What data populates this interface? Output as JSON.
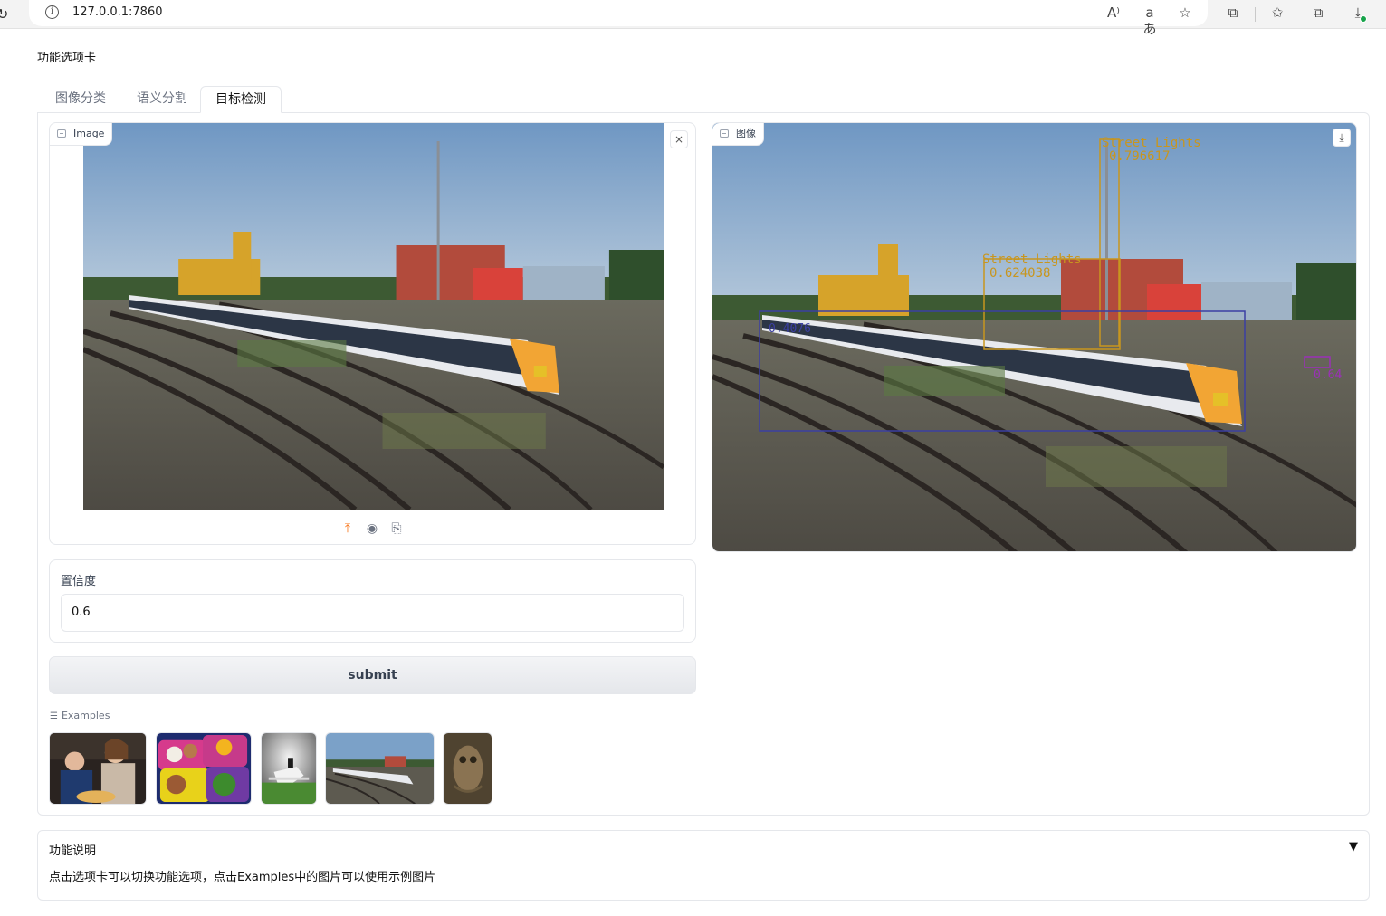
{
  "browser": {
    "url": "127.0.0.1:7860",
    "info_glyph": "i",
    "icons": [
      "read-aloud-icon",
      "translate-icon",
      "favorite-star-icon",
      "extensions-icon",
      "favorites-icon",
      "collections-icon",
      "downloads-icon"
    ],
    "read_aloud": "A⁾",
    "translate": "aあ",
    "favorite": "☆",
    "extensions": "⧉",
    "favorites": "✩",
    "collections": "⧉",
    "downloads": "⤓"
  },
  "page": {
    "heading": "功能选项卡",
    "tabs": [
      {
        "label": "图像分类",
        "active": false
      },
      {
        "label": "语义分割",
        "active": false
      },
      {
        "label": "目标检测",
        "active": true
      }
    ]
  },
  "input_image": {
    "label": "Image",
    "clear_glyph": "×",
    "source_icons": [
      "upload-icon",
      "webcam-icon",
      "clipboard-icon"
    ],
    "upload_glyph": "⤒",
    "webcam_glyph": "◉",
    "clipboard_glyph": "⎘"
  },
  "output_image": {
    "label": "图像",
    "download_glyph": "⤓",
    "detections": [
      {
        "label": "Street Lights",
        "score": "0.796617",
        "color": "#c8961e"
      },
      {
        "label": "Street Lights",
        "score": "0.624038",
        "color": "#c8961e"
      },
      {
        "label": "",
        "score": "0.4076",
        "color": "#3b3fa3"
      },
      {
        "label": "",
        "score": "0.64",
        "color": "#9b30b8"
      }
    ]
  },
  "confidence": {
    "label": "置信度",
    "value": "0.6"
  },
  "submit_label": "submit",
  "examples": {
    "label": "Examples",
    "icon_glyph": "☰",
    "items": [
      "example-family-dinner",
      "example-bento-lunch",
      "example-horse-jump",
      "example-train-yard",
      "example-owl"
    ]
  },
  "description": {
    "title": "功能说明",
    "arrow": "▼",
    "text": "点击选项卡可以切换功能选项，点击Examples中的图片可以使用示例图片"
  },
  "colors": {
    "accent": "#f97316",
    "border": "#e5e7eb",
    "sky": "#7aa0c8"
  }
}
